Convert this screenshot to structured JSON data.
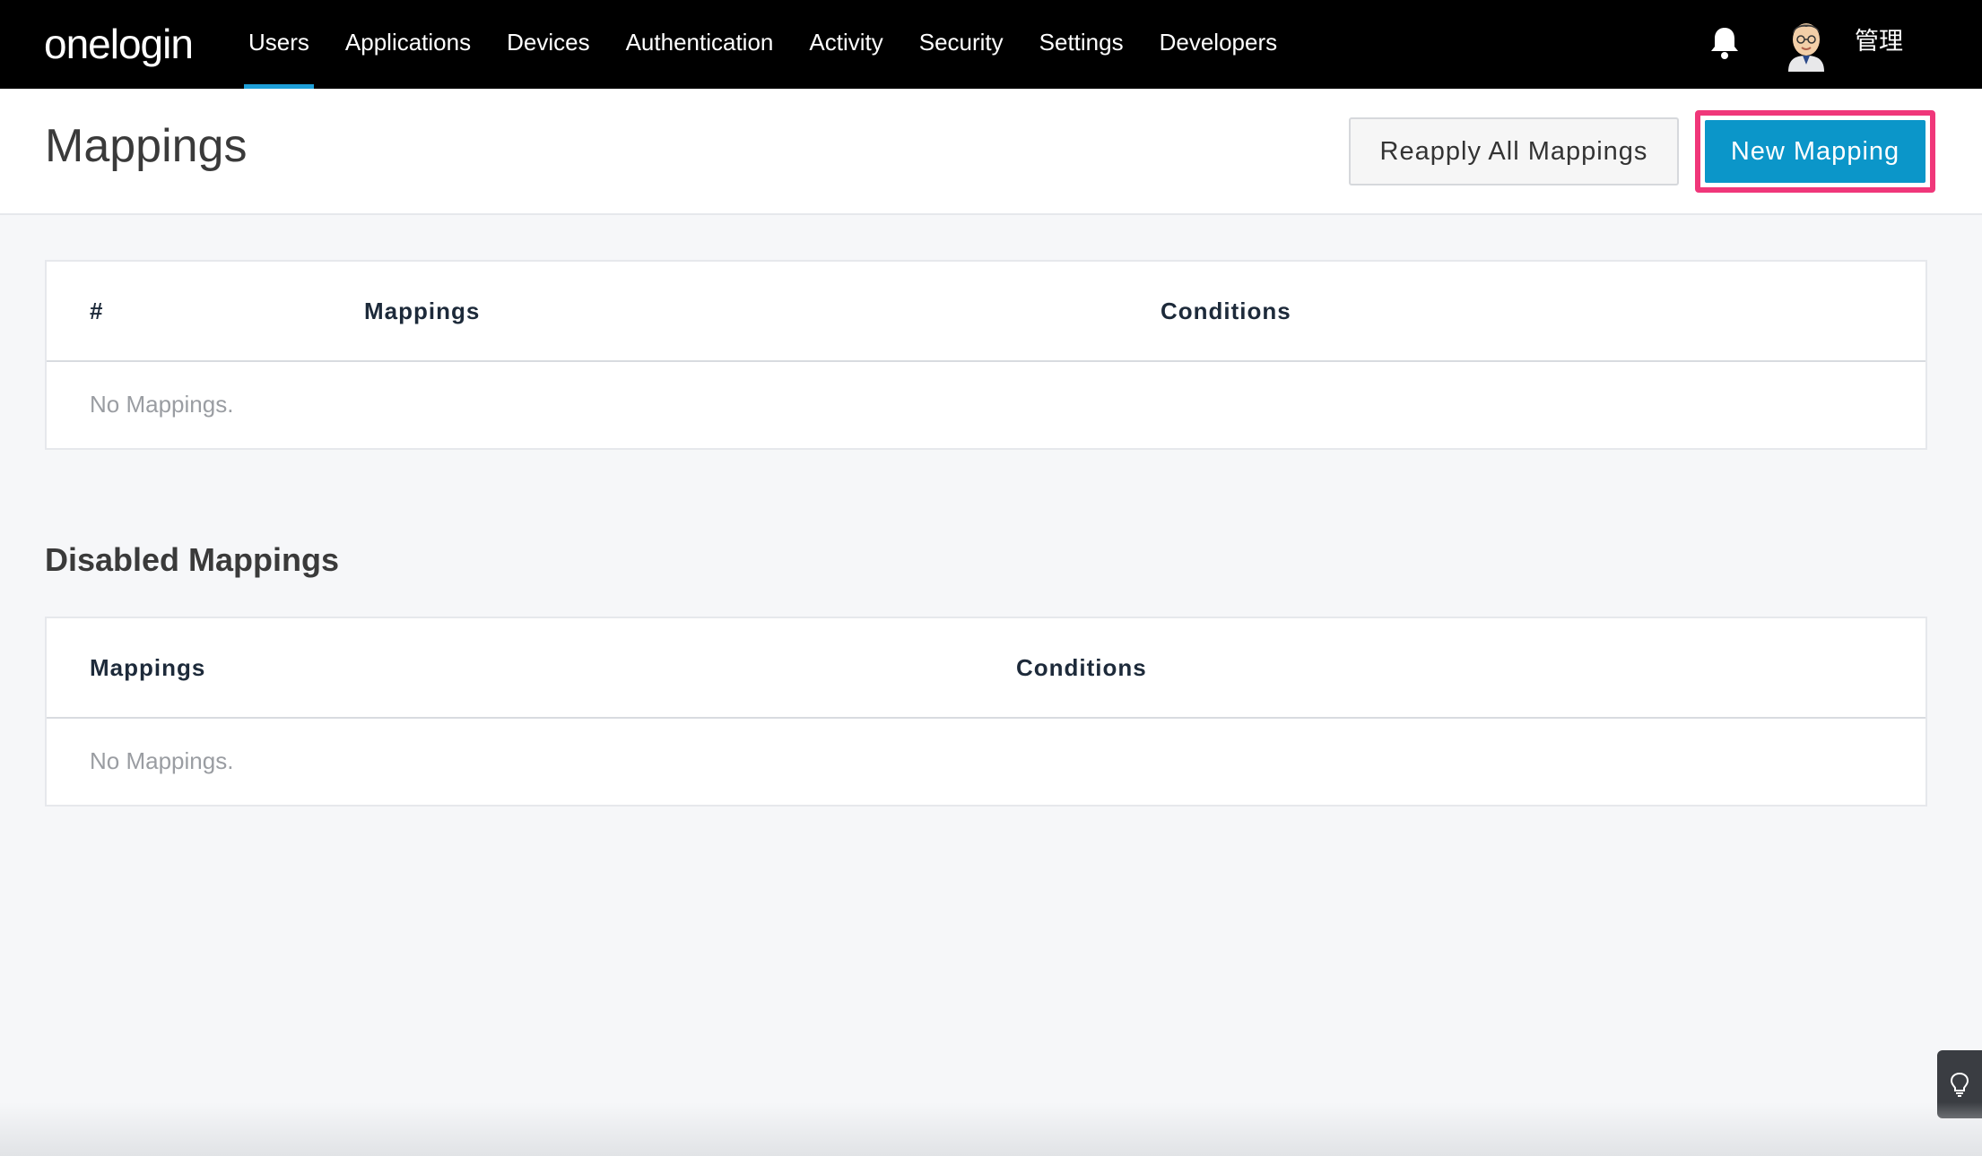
{
  "app": {
    "logo": "onelogin"
  },
  "nav": {
    "items": [
      {
        "label": "Users",
        "active": true
      },
      {
        "label": "Applications"
      },
      {
        "label": "Devices"
      },
      {
        "label": "Authentication"
      },
      {
        "label": "Activity"
      },
      {
        "label": "Security"
      },
      {
        "label": "Settings"
      },
      {
        "label": "Developers"
      }
    ],
    "notification_icon": "bell-icon",
    "user_name": "管理"
  },
  "header": {
    "title": "Mappings",
    "reapply_label": "Reapply All Mappings",
    "new_label": "New Mapping"
  },
  "mappings_table": {
    "columns": [
      "#",
      "Mappings",
      "Conditions"
    ],
    "empty_text": "No Mappings."
  },
  "disabled_section": {
    "title": "Disabled Mappings",
    "columns": [
      "Mappings",
      "Conditions"
    ],
    "empty_text": "No Mappings."
  },
  "colors": {
    "nav_bg": "#000000",
    "accent": "#1e9fd8",
    "primary_button": "#0b96c9",
    "highlight_border": "#f0377a"
  },
  "help_icon": "lightbulb-icon"
}
